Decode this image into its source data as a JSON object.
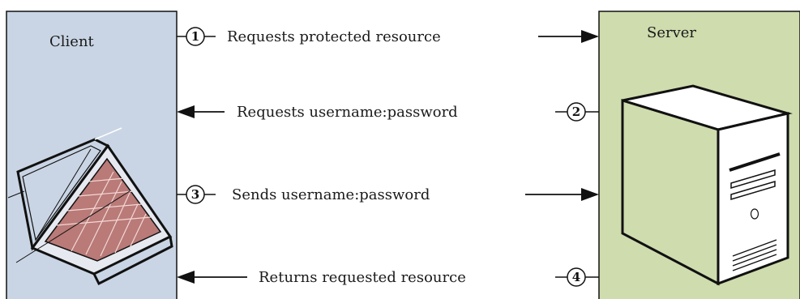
{
  "client": {
    "title": "Client",
    "color": "#c9d5e4"
  },
  "server": {
    "title": "Server",
    "color": "#cfdcae"
  },
  "steps": [
    {
      "number": "1",
      "label": "Requests protected resource",
      "direction": "client-to-server"
    },
    {
      "number": "2",
      "label": "Requests username:password",
      "direction": "server-to-client"
    },
    {
      "number": "3",
      "label": "Sends username:password",
      "direction": "client-to-server"
    },
    {
      "number": "4",
      "label": "Returns requested resource",
      "direction": "server-to-client"
    }
  ],
  "icons": {
    "client": "laptop-icon",
    "server": "server-tower-icon"
  }
}
